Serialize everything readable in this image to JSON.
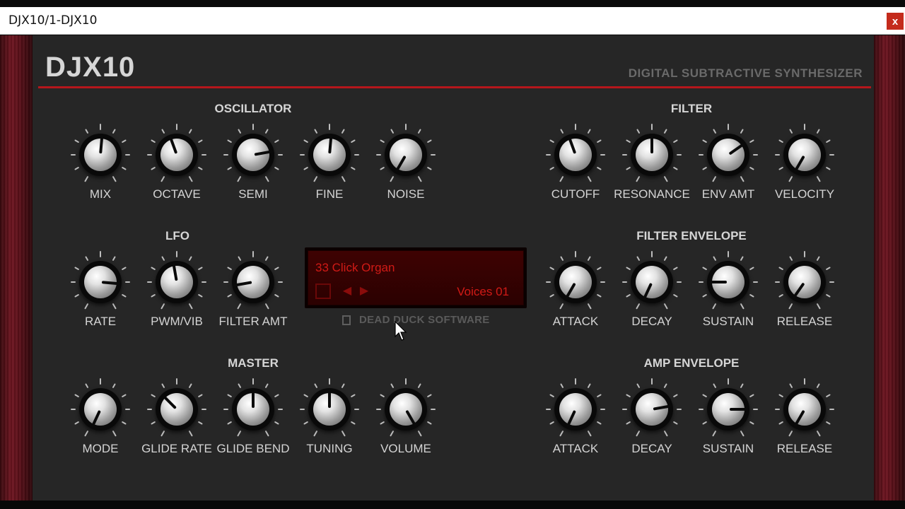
{
  "window": {
    "title": "DJX10/1-DJX10",
    "close_label": "x"
  },
  "header": {
    "logo": "DJX10",
    "subtitle": "DIGITAL SUBTRACTIVE SYNTHESIZER"
  },
  "colors": {
    "accent_red": "#b5161c",
    "lcd_text": "#d11a16",
    "wood": "#6e1520",
    "panel": "#262626"
  },
  "sections": {
    "oscillator": "OSCILLATOR",
    "filter": "FILTER",
    "lfo": "LFO",
    "filter_envelope": "FILTER ENVELOPE",
    "master": "MASTER",
    "amp_envelope": "AMP ENVELOPE"
  },
  "knobs": {
    "oscillator": [
      {
        "label": "MIX",
        "angle": 5
      },
      {
        "label": "OCTAVE",
        "angle": -20
      },
      {
        "label": "SEMI",
        "angle": 80
      },
      {
        "label": "FINE",
        "angle": 5
      },
      {
        "label": "NOISE",
        "angle": -150
      }
    ],
    "filter": [
      {
        "label": "CUTOFF",
        "angle": -20
      },
      {
        "label": "RESONANCE",
        "angle": 0
      },
      {
        "label": "ENV AMT",
        "angle": 55
      },
      {
        "label": "VELOCITY",
        "angle": -150
      }
    ],
    "lfo": [
      {
        "label": "RATE",
        "angle": 95
      },
      {
        "label": "PWM/VIB",
        "angle": -10
      },
      {
        "label": "FILTER AMT",
        "angle": -100
      }
    ],
    "filter_envelope": [
      {
        "label": "ATTACK",
        "angle": -150
      },
      {
        "label": "DECAY",
        "angle": -155
      },
      {
        "label": "SUSTAIN",
        "angle": -90
      },
      {
        "label": "RELEASE",
        "angle": -145
      }
    ],
    "master": [
      {
        "label": "MODE",
        "angle": -155
      },
      {
        "label": "GLIDE RATE",
        "angle": -45
      },
      {
        "label": "GLIDE BEND",
        "angle": 0
      },
      {
        "label": "TUNING",
        "angle": 0
      },
      {
        "label": "VOLUME",
        "angle": 150
      }
    ],
    "amp_envelope": [
      {
        "label": "ATTACK",
        "angle": -155
      },
      {
        "label": "DECAY",
        "angle": 80
      },
      {
        "label": "SUSTAIN",
        "angle": 90
      },
      {
        "label": "RELEASE",
        "angle": -150
      }
    ]
  },
  "lcd": {
    "patch": "33  Click Organ",
    "voices": "Voices 01",
    "save_icon": "save-icon",
    "prev_icon": "prev-arrow-icon",
    "next_icon": "next-arrow-icon"
  },
  "brand": "DEAD DUCK SOFTWARE"
}
